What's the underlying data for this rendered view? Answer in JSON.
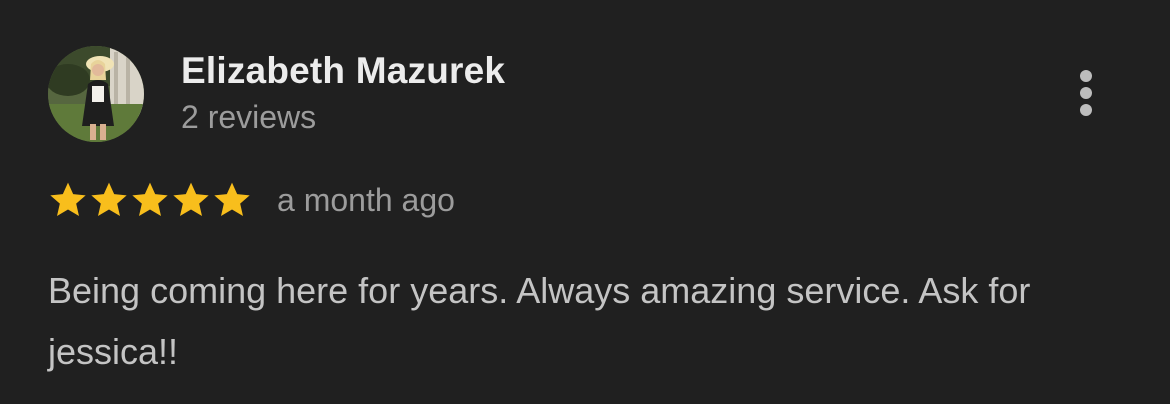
{
  "review": {
    "author_name": "Elizabeth Mazurek",
    "author_reviews": "2 reviews",
    "rating": 5,
    "rating_max": 5,
    "date": "a month ago",
    "text": "Being coming here for years. Always amazing service. Ask for jessica!!"
  },
  "icons": {
    "star": "star-icon",
    "menu": "more-vert-icon"
  },
  "colors": {
    "background": "#202020",
    "star": "#F8BE1C",
    "name": "#ECECEC",
    "secondary_text": "#9C9C9C",
    "body_text": "#C4C4C4"
  }
}
